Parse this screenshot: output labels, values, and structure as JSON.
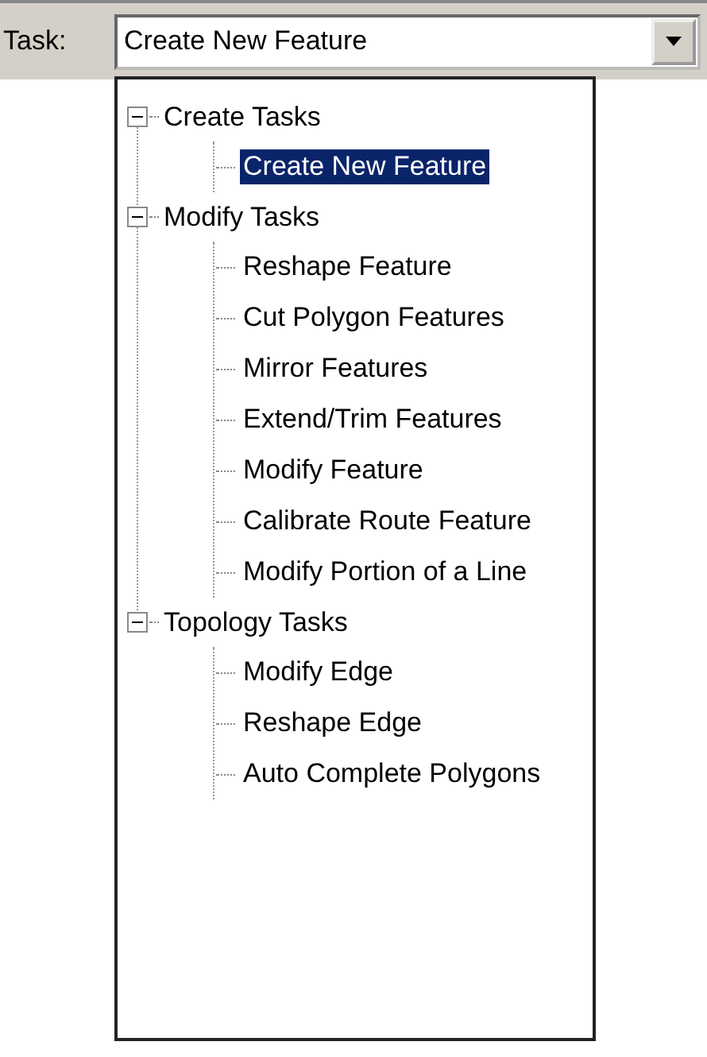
{
  "task_bar": {
    "label": "Task:",
    "value": "Create New Feature",
    "expanded": true
  },
  "tree": [
    {
      "label": "Create Tasks",
      "expanded": true,
      "children": [
        {
          "label": "Create New Feature",
          "selected": true
        }
      ]
    },
    {
      "label": "Modify Tasks",
      "expanded": true,
      "children": [
        {
          "label": "Reshape Feature",
          "selected": false
        },
        {
          "label": "Cut Polygon Features",
          "selected": false
        },
        {
          "label": "Mirror Features",
          "selected": false
        },
        {
          "label": "Extend/Trim Features",
          "selected": false
        },
        {
          "label": "Modify Feature",
          "selected": false
        },
        {
          "label": "Calibrate Route Feature",
          "selected": false
        },
        {
          "label": "Modify Portion of a Line",
          "selected": false
        }
      ]
    },
    {
      "label": "Topology Tasks",
      "expanded": true,
      "children": [
        {
          "label": "Modify Edge",
          "selected": false
        },
        {
          "label": "Reshape Edge",
          "selected": false
        },
        {
          "label": "Auto Complete Polygons",
          "selected": false
        }
      ]
    }
  ]
}
